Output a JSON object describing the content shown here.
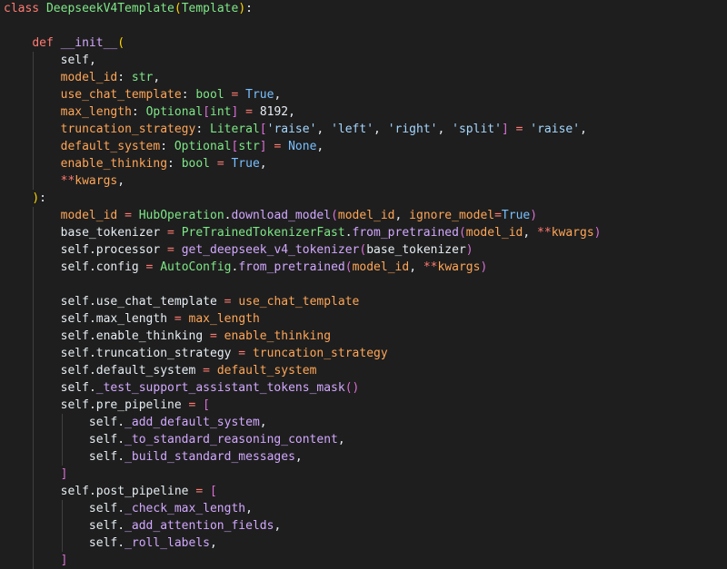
{
  "theme": {
    "background": "#1e1e1e",
    "indent_guide": "#404040",
    "colors": {
      "kw": "#ff7b72",
      "cls": "#7ee787",
      "fn": "#d2a8ff",
      "param": "#ffa657",
      "builtin": "#79c0ff",
      "str": "#a5d6ff",
      "num": "#e6edf3",
      "op": "#ff7b72",
      "pun": "#e6edf3",
      "self": "#e6edf3",
      "call": "#d2a8ff",
      "br1": "#ffd700",
      "br2": "#da70d6",
      "br3": "#179fff",
      "txt": "#e6edf3"
    }
  },
  "code_lines": [
    {
      "indent": 0,
      "tokens": [
        [
          "kw",
          "class "
        ],
        [
          "cls",
          "DeepseekV4Template"
        ],
        [
          "br1",
          "("
        ],
        [
          "cls",
          "Template"
        ],
        [
          "br1",
          ")"
        ],
        [
          "pun",
          ":"
        ]
      ]
    },
    {
      "indent": 0,
      "tokens": []
    },
    {
      "indent": 1,
      "tokens": [
        [
          "kw",
          "def "
        ],
        [
          "fn",
          "__init__"
        ],
        [
          "br1",
          "("
        ]
      ]
    },
    {
      "indent": 2,
      "tokens": [
        [
          "self",
          "self"
        ],
        [
          "pun",
          ","
        ]
      ]
    },
    {
      "indent": 2,
      "tokens": [
        [
          "param",
          "model_id"
        ],
        [
          "pun",
          ": "
        ],
        [
          "cls",
          "str"
        ],
        [
          "pun",
          ","
        ]
      ]
    },
    {
      "indent": 2,
      "tokens": [
        [
          "param",
          "use_chat_template"
        ],
        [
          "pun",
          ": "
        ],
        [
          "cls",
          "bool"
        ],
        [
          "op",
          " = "
        ],
        [
          "builtin",
          "True"
        ],
        [
          "pun",
          ","
        ]
      ]
    },
    {
      "indent": 2,
      "tokens": [
        [
          "param",
          "max_length"
        ],
        [
          "pun",
          ": "
        ],
        [
          "cls",
          "Optional"
        ],
        [
          "br2",
          "["
        ],
        [
          "cls",
          "int"
        ],
        [
          "br2",
          "]"
        ],
        [
          "op",
          " = "
        ],
        [
          "num",
          "8192"
        ],
        [
          "pun",
          ","
        ]
      ]
    },
    {
      "indent": 2,
      "tokens": [
        [
          "param",
          "truncation_strategy"
        ],
        [
          "pun",
          ": "
        ],
        [
          "cls",
          "Literal"
        ],
        [
          "br2",
          "["
        ],
        [
          "str",
          "'raise'"
        ],
        [
          "pun",
          ", "
        ],
        [
          "str",
          "'left'"
        ],
        [
          "pun",
          ", "
        ],
        [
          "str",
          "'right'"
        ],
        [
          "pun",
          ", "
        ],
        [
          "str",
          "'split'"
        ],
        [
          "br2",
          "]"
        ],
        [
          "op",
          " = "
        ],
        [
          "str",
          "'raise'"
        ],
        [
          "pun",
          ","
        ]
      ]
    },
    {
      "indent": 2,
      "tokens": [
        [
          "param",
          "default_system"
        ],
        [
          "pun",
          ": "
        ],
        [
          "cls",
          "Optional"
        ],
        [
          "br2",
          "["
        ],
        [
          "cls",
          "str"
        ],
        [
          "br2",
          "]"
        ],
        [
          "op",
          " = "
        ],
        [
          "builtin",
          "None"
        ],
        [
          "pun",
          ","
        ]
      ]
    },
    {
      "indent": 2,
      "tokens": [
        [
          "param",
          "enable_thinking"
        ],
        [
          "pun",
          ": "
        ],
        [
          "cls",
          "bool"
        ],
        [
          "op",
          " = "
        ],
        [
          "builtin",
          "True"
        ],
        [
          "pun",
          ","
        ]
      ]
    },
    {
      "indent": 2,
      "tokens": [
        [
          "op",
          "**"
        ],
        [
          "param",
          "kwargs"
        ],
        [
          "pun",
          ","
        ]
      ]
    },
    {
      "indent": 1,
      "tokens": [
        [
          "br1",
          ")"
        ],
        [
          "pun",
          ":"
        ]
      ]
    },
    {
      "indent": 2,
      "tokens": [
        [
          "param",
          "model_id"
        ],
        [
          "op",
          " = "
        ],
        [
          "cls",
          "HubOperation"
        ],
        [
          "pun",
          "."
        ],
        [
          "call",
          "download_model"
        ],
        [
          "br2",
          "("
        ],
        [
          "param",
          "model_id"
        ],
        [
          "pun",
          ", "
        ],
        [
          "param",
          "ignore_model"
        ],
        [
          "op",
          "="
        ],
        [
          "builtin",
          "True"
        ],
        [
          "br2",
          ")"
        ]
      ]
    },
    {
      "indent": 2,
      "tokens": [
        [
          "txt",
          "base_tokenizer"
        ],
        [
          "op",
          " = "
        ],
        [
          "cls",
          "PreTrainedTokenizerFast"
        ],
        [
          "pun",
          "."
        ],
        [
          "call",
          "from_pretrained"
        ],
        [
          "br2",
          "("
        ],
        [
          "param",
          "model_id"
        ],
        [
          "pun",
          ", "
        ],
        [
          "op",
          "**"
        ],
        [
          "param",
          "kwargs"
        ],
        [
          "br2",
          ")"
        ]
      ]
    },
    {
      "indent": 2,
      "tokens": [
        [
          "self",
          "self"
        ],
        [
          "pun",
          "."
        ],
        [
          "txt",
          "processor"
        ],
        [
          "op",
          " = "
        ],
        [
          "call",
          "get_deepseek_v4_tokenizer"
        ],
        [
          "br2",
          "("
        ],
        [
          "txt",
          "base_tokenizer"
        ],
        [
          "br2",
          ")"
        ]
      ]
    },
    {
      "indent": 2,
      "tokens": [
        [
          "self",
          "self"
        ],
        [
          "pun",
          "."
        ],
        [
          "txt",
          "config"
        ],
        [
          "op",
          " = "
        ],
        [
          "cls",
          "AutoConfig"
        ],
        [
          "pun",
          "."
        ],
        [
          "call",
          "from_pretrained"
        ],
        [
          "br2",
          "("
        ],
        [
          "param",
          "model_id"
        ],
        [
          "pun",
          ", "
        ],
        [
          "op",
          "**"
        ],
        [
          "param",
          "kwargs"
        ],
        [
          "br2",
          ")"
        ]
      ]
    },
    {
      "indent": 2,
      "tokens": []
    },
    {
      "indent": 2,
      "tokens": [
        [
          "self",
          "self"
        ],
        [
          "pun",
          "."
        ],
        [
          "txt",
          "use_chat_template"
        ],
        [
          "op",
          " = "
        ],
        [
          "param",
          "use_chat_template"
        ]
      ]
    },
    {
      "indent": 2,
      "tokens": [
        [
          "self",
          "self"
        ],
        [
          "pun",
          "."
        ],
        [
          "txt",
          "max_length"
        ],
        [
          "op",
          " = "
        ],
        [
          "param",
          "max_length"
        ]
      ]
    },
    {
      "indent": 2,
      "tokens": [
        [
          "self",
          "self"
        ],
        [
          "pun",
          "."
        ],
        [
          "txt",
          "enable_thinking"
        ],
        [
          "op",
          " = "
        ],
        [
          "param",
          "enable_thinking"
        ]
      ]
    },
    {
      "indent": 2,
      "tokens": [
        [
          "self",
          "self"
        ],
        [
          "pun",
          "."
        ],
        [
          "txt",
          "truncation_strategy"
        ],
        [
          "op",
          " = "
        ],
        [
          "param",
          "truncation_strategy"
        ]
      ]
    },
    {
      "indent": 2,
      "tokens": [
        [
          "self",
          "self"
        ],
        [
          "pun",
          "."
        ],
        [
          "txt",
          "default_system"
        ],
        [
          "op",
          " = "
        ],
        [
          "param",
          "default_system"
        ]
      ]
    },
    {
      "indent": 2,
      "tokens": [
        [
          "self",
          "self"
        ],
        [
          "pun",
          "."
        ],
        [
          "call",
          "_test_support_assistant_tokens_mask"
        ],
        [
          "br2",
          "()"
        ]
      ]
    },
    {
      "indent": 2,
      "tokens": [
        [
          "self",
          "self"
        ],
        [
          "pun",
          "."
        ],
        [
          "txt",
          "pre_pipeline"
        ],
        [
          "op",
          " = "
        ],
        [
          "br2",
          "["
        ]
      ]
    },
    {
      "indent": 3,
      "tokens": [
        [
          "self",
          "self"
        ],
        [
          "pun",
          "."
        ],
        [
          "call",
          "_add_default_system"
        ],
        [
          "pun",
          ","
        ]
      ]
    },
    {
      "indent": 3,
      "tokens": [
        [
          "self",
          "self"
        ],
        [
          "pun",
          "."
        ],
        [
          "call",
          "_to_standard_reasoning_content"
        ],
        [
          "pun",
          ","
        ]
      ]
    },
    {
      "indent": 3,
      "tokens": [
        [
          "self",
          "self"
        ],
        [
          "pun",
          "."
        ],
        [
          "call",
          "_build_standard_messages"
        ],
        [
          "pun",
          ","
        ]
      ]
    },
    {
      "indent": 2,
      "tokens": [
        [
          "br2",
          "]"
        ]
      ]
    },
    {
      "indent": 2,
      "tokens": [
        [
          "self",
          "self"
        ],
        [
          "pun",
          "."
        ],
        [
          "txt",
          "post_pipeline"
        ],
        [
          "op",
          " = "
        ],
        [
          "br2",
          "["
        ]
      ]
    },
    {
      "indent": 3,
      "tokens": [
        [
          "self",
          "self"
        ],
        [
          "pun",
          "."
        ],
        [
          "call",
          "_check_max_length"
        ],
        [
          "pun",
          ","
        ]
      ]
    },
    {
      "indent": 3,
      "tokens": [
        [
          "self",
          "self"
        ],
        [
          "pun",
          "."
        ],
        [
          "call",
          "_add_attention_fields"
        ],
        [
          "pun",
          ","
        ]
      ]
    },
    {
      "indent": 3,
      "tokens": [
        [
          "self",
          "self"
        ],
        [
          "pun",
          "."
        ],
        [
          "call",
          "_roll_labels"
        ],
        [
          "pun",
          ","
        ]
      ]
    },
    {
      "indent": 2,
      "tokens": [
        [
          "br2",
          "]"
        ]
      ]
    }
  ]
}
